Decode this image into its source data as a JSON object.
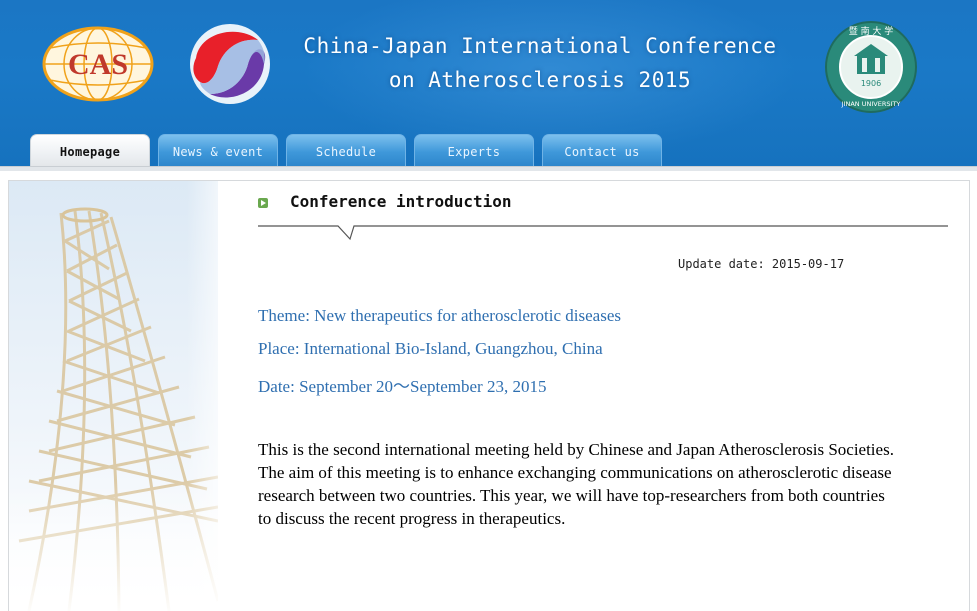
{
  "header": {
    "title_line1": "China-Japan International Conference",
    "title_line2": "on Atherosclerosis 2015",
    "logo_left_text": "CAS",
    "logo_right_top": "暨 南 大 学",
    "logo_right_year": "1906",
    "logo_right_bottom": "JINAN UNIVERSITY",
    "colors": {
      "banner": "#1b76c4",
      "tab": "#3f98da",
      "accent_text": "#2f6fb0"
    }
  },
  "nav": {
    "tabs": [
      {
        "label": "Homepage",
        "active": true
      },
      {
        "label": "News & event",
        "active": false
      },
      {
        "label": "Schedule",
        "active": false
      },
      {
        "label": "Experts",
        "active": false
      },
      {
        "label": "Contact us",
        "active": false
      }
    ]
  },
  "main": {
    "section_title": "Conference introduction",
    "section_icon": "play-bullet-icon",
    "update_date": "Update date: 2015-09-17",
    "theme": "Theme: New therapeutics for atherosclerotic diseases",
    "place": "Place: International Bio-Island, Guangzhou, China",
    "date": "Date: September 20～September 23, 2015",
    "paragraph": "This is the second international meeting held by Chinese and Japan Atherosclerosis Societies. The aim of this meeting is to enhance exchanging communications on atherosclerotic disease research between two countries. This year, we will have top-researchers from both countries to discuss the recent progress in therapeutics."
  }
}
